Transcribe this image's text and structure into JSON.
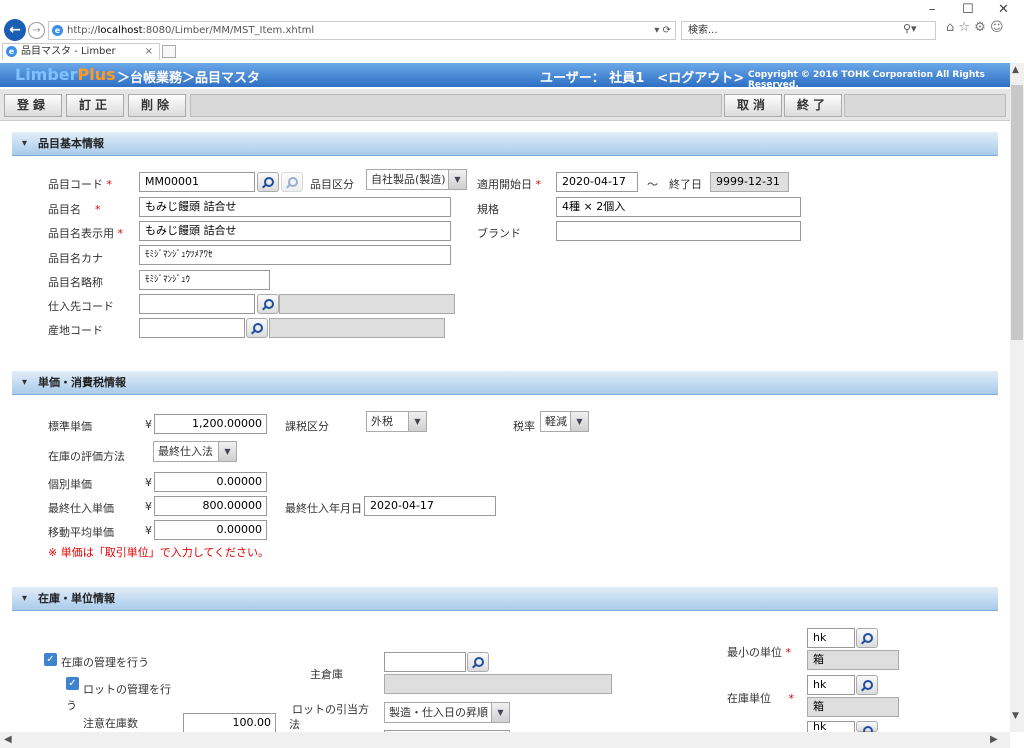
{
  "browser": {
    "url_prefix": "http://",
    "url_host": "localhost",
    "url_rest": ":8080/Limber/MM/MST_Item.xhtml",
    "search_placeholder": "検索...",
    "tab_title": "品目マスタ - Limber",
    "tab_close": "×",
    "win_min": "–",
    "win_max": "☐",
    "win_close": "✕",
    "back": "←",
    "fwd": "→",
    "addr_ctrl": "▾ ⟳",
    "search_ctrl": "⚲▾",
    "right_icons": "⌂ ☆ ⚙ ☺"
  },
  "header": {
    "logo_limber": "Limber",
    "logo_plus": "Plus",
    "breadcrumb": "＞台帳業務＞品目マスタ",
    "user": "ユーザー： 社員1　<ログアウト>",
    "copyright": "Copyright © 2016 TOHK Corporation All Rights Reserved."
  },
  "toolbar": {
    "register": "登録",
    "correct": "訂正",
    "delete": "削除",
    "cancel": "取消",
    "finish": "終了"
  },
  "section1": {
    "title": "品目基本情報",
    "item_code_label": "品目コード",
    "item_code": "MM00001",
    "item_kind_label": "品目区分",
    "item_kind": "自社製品(製造)",
    "start_date_label": "適用開始日",
    "start_date": "2020-04-17",
    "tilde": "～",
    "end_date_label": "終了日",
    "end_date": "9999-12-31",
    "item_name_label": "品目名",
    "item_name": "もみじ饅頭 詰合せ",
    "spec_label": "規格",
    "spec": "4種 × 2個入",
    "display_name_label": "品目名表示用",
    "display_name": "もみじ饅頭 詰合せ",
    "brand_label": "ブランド",
    "brand": "",
    "kana_label": "品目名カナ",
    "kana": "ﾓﾐｼﾞﾏﾝｼﾞｭｳﾂﾒｱﾜｾ",
    "short_label": "品目名略称",
    "short": "ﾓﾐｼﾞﾏﾝｼﾞｭｳ",
    "supplier_label": "仕入先コード",
    "origin_label": "産地コード",
    "asterisk": "*"
  },
  "section2": {
    "title": "単価・消費税情報",
    "std_price_label": "標準単価",
    "yen": "¥",
    "std_price": "1,200.00000",
    "tax_kind_label": "課税区分",
    "tax_kind": "外税",
    "tax_rate_label": "税率",
    "tax_rate": "軽減",
    "valuation_label": "在庫の評価方法",
    "valuation": "最終仕入法",
    "indiv_price_label": "個別単価",
    "indiv_price": "0.00000",
    "last_purchase_price_label": "最終仕入単価",
    "last_purchase_price": "800.00000",
    "last_purchase_date_label": "最終仕入年月日",
    "last_purchase_date": "2020-04-17",
    "moving_avg_label": "移動平均単価",
    "moving_avg": "0.00000",
    "note": "※ 単価は「取引単位」で入力してください。"
  },
  "section3": {
    "title": "在庫・単位情報",
    "manage_stock": "在庫の管理を行う",
    "manage_lot_line1": "ロットの管理を行",
    "manage_lot_line2": "う",
    "caution_label": "注意在庫数",
    "caution_value": "100.00",
    "warehouse_label": "主倉庫",
    "lot_method_label_line1": "ロットの引当方",
    "lot_method_label_line2": "法",
    "lot_method": "製造・仕入日の昇順",
    "min_unit_label": "最小の単位",
    "min_unit_code": "hk",
    "min_unit_name": "箱",
    "stock_unit_label": "在庫単位",
    "stock_unit_code": "hk",
    "stock_unit_name": "箱",
    "third_unit_code": "hk",
    "check": "✓"
  }
}
